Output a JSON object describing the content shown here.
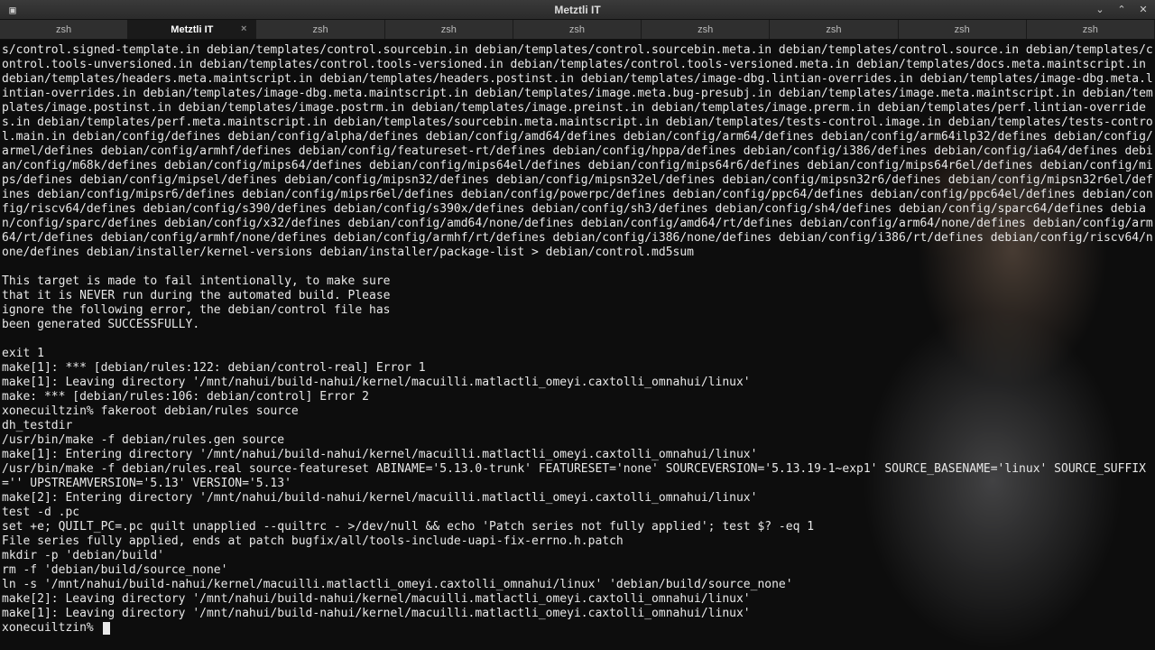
{
  "window": {
    "title": "Metztli IT"
  },
  "tabs": [
    {
      "label": "zsh",
      "active": false
    },
    {
      "label": "Metztli IT",
      "active": true,
      "closeable": true
    },
    {
      "label": "zsh",
      "active": false
    },
    {
      "label": "zsh",
      "active": false
    },
    {
      "label": "zsh",
      "active": false
    },
    {
      "label": "zsh",
      "active": false
    },
    {
      "label": "zsh",
      "active": false
    },
    {
      "label": "zsh",
      "active": false
    },
    {
      "label": "zsh",
      "active": false
    }
  ],
  "term": {
    "block1": "s/control.signed-template.in debian/templates/control.sourcebin.in debian/templates/control.sourcebin.meta.in debian/templates/control.source.in debian/templates/control.tools-unversioned.in debian/templates/control.tools-versioned.in debian/templates/control.tools-versioned.meta.in debian/templates/docs.meta.maintscript.in debian/templates/headers.meta.maintscript.in debian/templates/headers.postinst.in debian/templates/image-dbg.lintian-overrides.in debian/templates/image-dbg.meta.lintian-overrides.in debian/templates/image-dbg.meta.maintscript.in debian/templates/image.meta.bug-presubj.in debian/templates/image.meta.maintscript.in debian/templates/image.postinst.in debian/templates/image.postrm.in debian/templates/image.preinst.in debian/templates/image.prerm.in debian/templates/perf.lintian-overrides.in debian/templates/perf.meta.maintscript.in debian/templates/sourcebin.meta.maintscript.in debian/templates/tests-control.image.in debian/templates/tests-control.main.in debian/config/defines debian/config/alpha/defines debian/config/amd64/defines debian/config/arm64/defines debian/config/arm64ilp32/defines debian/config/armel/defines debian/config/armhf/defines debian/config/featureset-rt/defines debian/config/hppa/defines debian/config/i386/defines debian/config/ia64/defines debian/config/m68k/defines debian/config/mips64/defines debian/config/mips64el/defines debian/config/mips64r6/defines debian/config/mips64r6el/defines debian/config/mips/defines debian/config/mipsel/defines debian/config/mipsn32/defines debian/config/mipsn32el/defines debian/config/mipsn32r6/defines debian/config/mipsn32r6el/defines debian/config/mipsr6/defines debian/config/mipsr6el/defines debian/config/powerpc/defines debian/config/ppc64/defines debian/config/ppc64el/defines debian/config/riscv64/defines debian/config/s390/defines debian/config/s390x/defines debian/config/sh3/defines debian/config/sh4/defines debian/config/sparc64/defines debian/config/sparc/defines debian/config/x32/defines debian/config/amd64/none/defines debian/config/amd64/rt/defines debian/config/arm64/none/defines debian/config/arm64/rt/defines debian/config/armhf/none/defines debian/config/armhf/rt/defines debian/config/i386/none/defines debian/config/i386/rt/defines debian/config/riscv64/none/defines debian/installer/kernel-versions debian/installer/package-list > debian/control.md5sum",
    "msg1": "This target is made to fail intentionally, to make sure",
    "msg2": "that it is NEVER run during the automated build. Please",
    "msg3": "ignore the following error, the debian/control file has",
    "msg4": "been generated SUCCESSFULLY.",
    "exit": "exit 1",
    "make1": "make[1]: *** [debian/rules:122: debian/control-real] Error 1",
    "make2": "make[1]: Leaving directory '/mnt/nahui/build-nahui/kernel/macuilli.matlactli_omeyi.caxtolli_omnahui/linux'",
    "make3": "make: *** [debian/rules:106: debian/control] Error 2",
    "prompt1": "xonecuiltzin% fakeroot debian/rules source",
    "dh": "dh_testdir",
    "usrbin1": "/usr/bin/make -f debian/rules.gen source",
    "make4": "make[1]: Entering directory '/mnt/nahui/build-nahui/kernel/macuilli.matlactli_omeyi.caxtolli_omnahui/linux'",
    "usrbin2": "/usr/bin/make -f debian/rules.real source-featureset ABINAME='5.13.0-trunk' FEATURESET='none' SOURCEVERSION='5.13.19-1~exp1' SOURCE_BASENAME='linux' SOURCE_SUFFIX='' UPSTREAMVERSION='5.13' VERSION='5.13'",
    "make5": "make[2]: Entering directory '/mnt/nahui/build-nahui/kernel/macuilli.matlactli_omeyi.caxtolli_omnahui/linux'",
    "testd": "test -d .pc",
    "sete": "set +e; QUILT_PC=.pc quilt unapplied --quiltrc - >/dev/null && echo 'Patch series not fully applied'; test $? -eq 1",
    "fileseries": "File series fully applied, ends at patch bugfix/all/tools-include-uapi-fix-errno.h.patch",
    "mkdir": "mkdir -p 'debian/build'",
    "rmf": "rm -f 'debian/build/source_none'",
    "lns": "ln -s '/mnt/nahui/build-nahui/kernel/macuilli.matlactli_omeyi.caxtolli_omnahui/linux' 'debian/build/source_none'",
    "make6": "make[2]: Leaving directory '/mnt/nahui/build-nahui/kernel/macuilli.matlactli_omeyi.caxtolli_omnahui/linux'",
    "make7": "make[1]: Leaving directory '/mnt/nahui/build-nahui/kernel/macuilli.matlactli_omeyi.caxtolli_omnahui/linux'",
    "prompt2": "xonecuiltzin% "
  }
}
